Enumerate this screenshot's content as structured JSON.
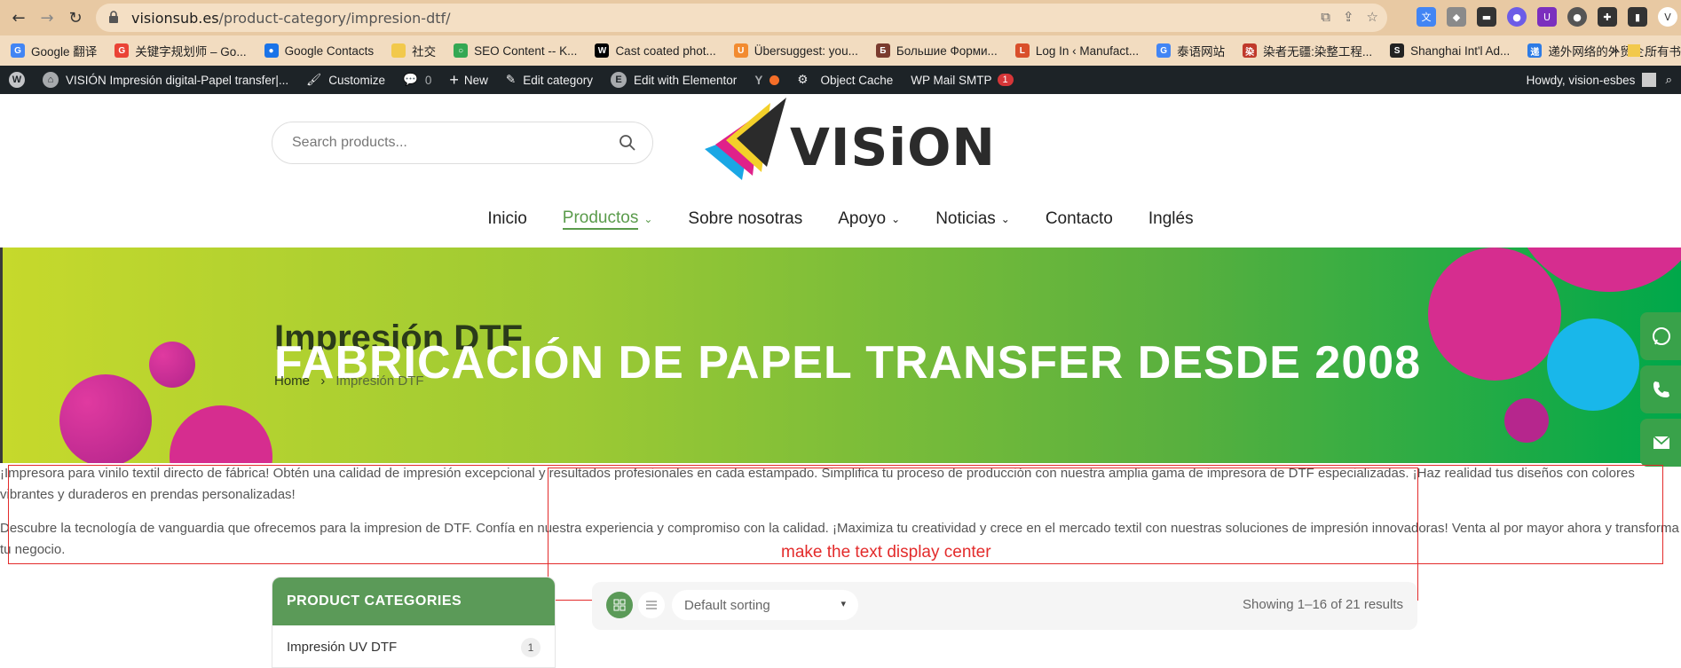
{
  "browser": {
    "url_host": "visionsub.es",
    "url_path": "/product-category/impresion-dtf/",
    "bookmarks": [
      {
        "label": "Google 翻译",
        "color": "#4285f4",
        "glyph": "G"
      },
      {
        "label": "关键字规划师 – Go...",
        "color": "#ea4335",
        "glyph": "G"
      },
      {
        "label": "Google Contacts",
        "color": "#1a73e8",
        "glyph": "●"
      },
      {
        "label": "社交",
        "color": "#f2c94c",
        "glyph": ""
      },
      {
        "label": "SEO Content -- K...",
        "color": "#34a853",
        "glyph": "○"
      },
      {
        "label": "Cast coated phot...",
        "color": "#000000",
        "glyph": "W"
      },
      {
        "label": "Übersuggest: you...",
        "color": "#f28b30",
        "glyph": "U"
      },
      {
        "label": "Большие Форми...",
        "color": "#7a3b2e",
        "glyph": "Б"
      },
      {
        "label": "Log In ‹ Manufact...",
        "color": "#d94f2b",
        "glyph": "L"
      },
      {
        "label": "泰语网站",
        "color": "#4285f4",
        "glyph": "G"
      },
      {
        "label": "染者无疆:染整工程...",
        "color": "#c0392b",
        "glyph": "染"
      },
      {
        "label": "Shanghai Int'l Ad...",
        "color": "#222222",
        "glyph": "S"
      },
      {
        "label": "递外网络的外贸企...",
        "color": "#2d7be5",
        "glyph": "递"
      }
    ],
    "bookmarks_more": "»",
    "bookmarks_folder": "所有书"
  },
  "adminbar": {
    "site_name": "VISIÓN Impresión digital-Papel transfer|...",
    "customize": "Customize",
    "comments_count": "0",
    "new": "New",
    "edit_category": "Edit category",
    "edit_elementor": "Edit with Elementor",
    "object_cache": "Object Cache",
    "wp_mail_smtp": "WP Mail SMTP",
    "wp_mail_badge": "1",
    "howdy": "Howdy, vision-esbes"
  },
  "header": {
    "search_placeholder": "Search products...",
    "logo_text": "VISiON",
    "nav": [
      {
        "label": "Inicio",
        "dropdown": false
      },
      {
        "label": "Productos",
        "dropdown": true
      },
      {
        "label": "Sobre nosotras",
        "dropdown": false
      },
      {
        "label": "Apoyo",
        "dropdown": true
      },
      {
        "label": "Noticias",
        "dropdown": true
      },
      {
        "label": "Contacto",
        "dropdown": false
      },
      {
        "label": "Inglés",
        "dropdown": false
      }
    ]
  },
  "hero": {
    "title": "Impresión DTF",
    "overlay_text": "FABRICACIÓN DE PAPEL TRANSFER DESDE 2008",
    "breadcrumb_home": "Home",
    "breadcrumb_sep": "›",
    "breadcrumb_current": "Impresión DTF"
  },
  "intro": {
    "p1": "¡Impresora para vinilo textil directo de fábrica! Obtén una calidad de impresión excepcional y resultados profesionales en cada estampado. Simplifica tu proceso de producción con nuestra amplia gama de impresora de DTF especializadas. ¡Haz realidad tus diseños con colores vibrantes y duraderos en prendas personalizadas!",
    "p2": "Descubre la tecnología de vanguardia que ofrecemos para la impresion de DTF. Confía en nuestra experiencia y compromiso con la calidad. ¡Maximiza tu creatividad y crece en el mercado textil con nuestras soluciones de impresión innovadoras! Venta al por mayor ahora y transforma tu negocio."
  },
  "annotation": {
    "text": "make the text display center",
    "color": "#e32b2b"
  },
  "sidebar": {
    "heading": "PRODUCT CATEGORIES",
    "categories": [
      {
        "label": "Impresión UV DTF",
        "count": "1"
      }
    ]
  },
  "shop_toolbar": {
    "sort_selected": "Default sorting",
    "results": "Showing 1–16 of 21 results"
  },
  "colors": {
    "brand_green": "#5b9a58",
    "adminbar_bg": "#1d2327"
  }
}
